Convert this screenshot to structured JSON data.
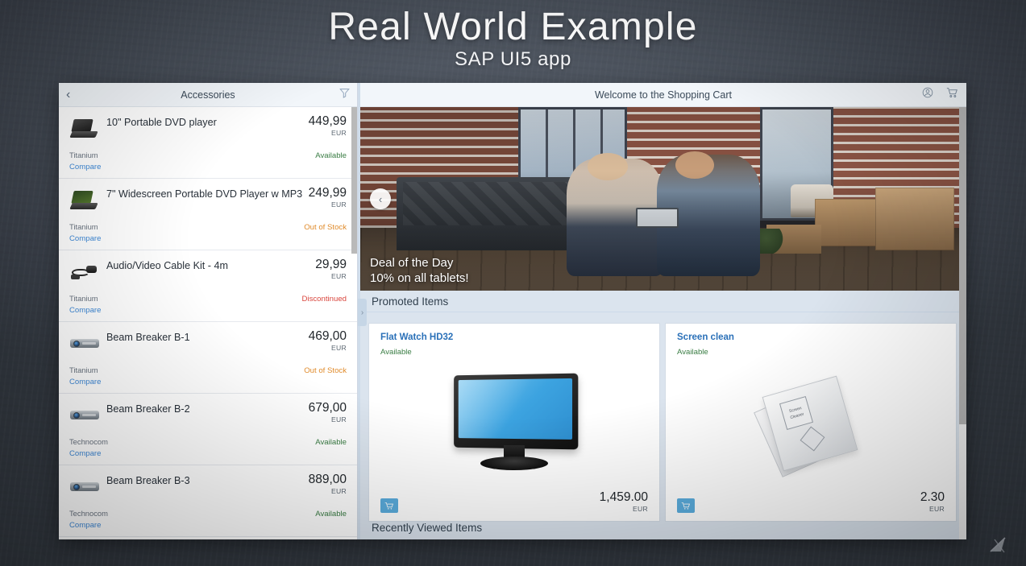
{
  "slide": {
    "title": "Real World Example",
    "subtitle": "SAP UI5 app"
  },
  "master": {
    "back_icon": "chevron-left-icon",
    "title": "Accessories",
    "filter_icon": "filter-icon",
    "compare_label": "Compare",
    "items": [
      {
        "name": "10\" Portable DVD player",
        "price": "449,99",
        "currency": "EUR",
        "vendor": "Titanium",
        "status": "Available",
        "status_type": "available",
        "thumb": "dvd-player-icon",
        "compare": "Compare"
      },
      {
        "name": "7\" Widescreen Portable DVD Player w MP3",
        "price": "249,99",
        "currency": "EUR",
        "vendor": "Titanium",
        "status": "Out of Stock",
        "status_type": "out",
        "thumb": "dvd-player-green-icon",
        "compare": "Compare"
      },
      {
        "name": "Audio/Video Cable Kit - 4m",
        "price": "29,99",
        "currency": "EUR",
        "vendor": "Titanium",
        "status": "Discontinued",
        "status_type": "disc",
        "thumb": "cable-kit-icon",
        "compare": "Compare"
      },
      {
        "name": "Beam Breaker B-1",
        "price": "469,00",
        "currency": "EUR",
        "vendor": "Titanium",
        "status": "Out of Stock",
        "status_type": "out",
        "thumb": "projector-icon",
        "compare": "Compare"
      },
      {
        "name": "Beam Breaker B-2",
        "price": "679,00",
        "currency": "EUR",
        "vendor": "Technocom",
        "status": "Available",
        "status_type": "available",
        "thumb": "projector-icon",
        "compare": "Compare"
      },
      {
        "name": "Beam Breaker B-3",
        "price": "889,00",
        "currency": "EUR",
        "vendor": "Technocom",
        "status": "Available",
        "status_type": "available",
        "thumb": "projector-icon",
        "compare": "Compare"
      }
    ]
  },
  "detail": {
    "title": "Welcome to the Shopping Cart",
    "account_icon": "user-account-icon",
    "cart_icon": "shopping-cart-icon",
    "hero": {
      "caption_line1": "Deal of the Day",
      "caption_line2": "10% on all tablets!",
      "prev_icon": "chevron-left-icon"
    },
    "splitter_icon": "chevron-right-icon",
    "promoted_section": "Promoted Items",
    "recent_section": "Recently Viewed Items",
    "cards": [
      {
        "title": "Flat Watch HD32",
        "status": "Available",
        "price": "1,459.00",
        "currency": "EUR",
        "image": "flat-monitor-image",
        "cart_icon": "add-to-cart-icon"
      },
      {
        "title": "Screen clean",
        "status": "Available",
        "price": "2.30",
        "currency": "EUR",
        "image": "screen-cleaner-image",
        "cart_icon": "add-to-cart-icon"
      }
    ]
  },
  "watermark_icon": "presentation-logo-icon",
  "colors": {
    "accent_blue": "#2a70b8",
    "link_blue": "#3f8ad8",
    "available_green": "#3a7d44",
    "out_of_stock_orange": "#e08b2b",
    "discontinued_red": "#d9453c",
    "cart_button": "#5badde",
    "section_bar": "#dbe4ee"
  }
}
